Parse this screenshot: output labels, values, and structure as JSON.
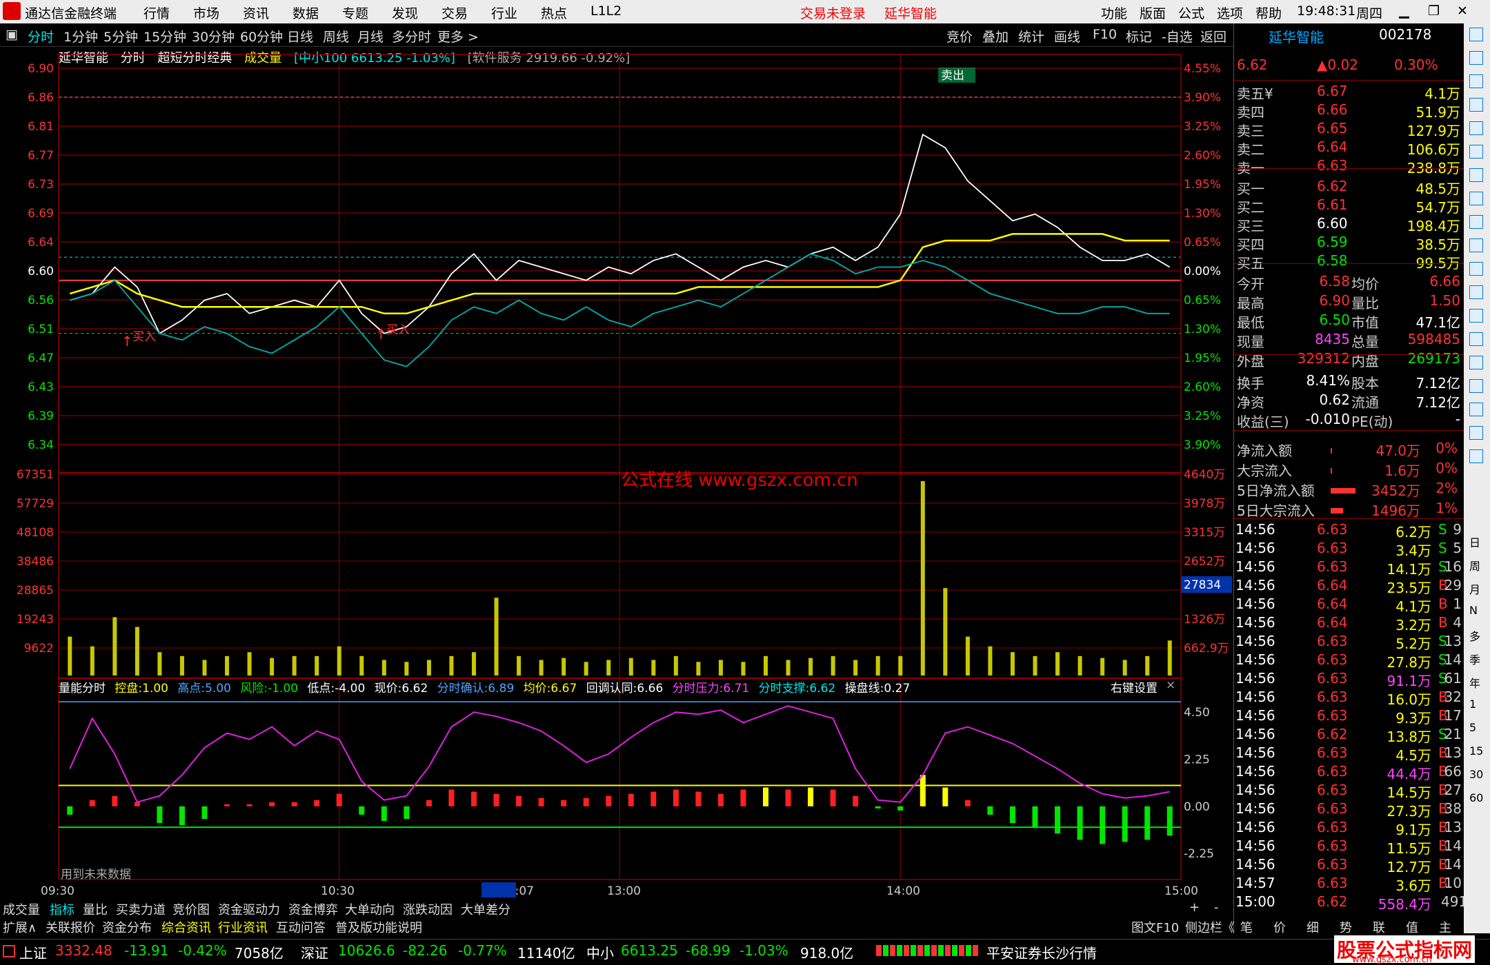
{
  "menu": {
    "app_title": "通达信金融终端",
    "items": [
      "行情",
      "市场",
      "资讯",
      "数据",
      "专题",
      "发现",
      "交易",
      "行业",
      "热点",
      "L1L2"
    ],
    "login": "交易未登录",
    "stock_name": "延华智能",
    "right_items": [
      "功能",
      "版面",
      "公式",
      "选项",
      "帮助"
    ],
    "time": "19:48:31",
    "weekday": "周四"
  },
  "toolbar": {
    "periods": [
      "分时",
      "1分钟",
      "5分钟",
      "15分钟",
      "30分钟",
      "60分钟",
      "日线",
      "周线",
      "月线",
      "多分时",
      "更多 >"
    ],
    "tools": [
      "竞价",
      "叠加",
      "统计",
      "画线",
      "F10",
      "标记",
      "-自选",
      "返回"
    ]
  },
  "chart_header": {
    "name": "延华智能",
    "mode": "分时",
    "formula": "超短分时经典",
    "vol_label": "成交量",
    "index1": "[中小100 6613.25 -1.03%]",
    "index2": "[软件服务 2919.66 -0.92%]"
  },
  "watermark": "公式在线 www.gszx.com.cn",
  "markers": {
    "buy": "买入",
    "sell": "卖出"
  },
  "chart_data": {
    "type": "line",
    "x_ticks": [
      "09:30",
      "10:30",
      "11:07",
      "13:00",
      "14:00",
      "15:00"
    ],
    "price_ticks": [
      "6.90",
      "6.86",
      "6.81",
      "6.77",
      "6.73",
      "6.69",
      "6.64",
      "6.60",
      "6.56",
      "6.51",
      "6.47",
      "6.43",
      "6.39",
      "6.34"
    ],
    "pct_ticks": [
      "4.55%",
      "3.90%",
      "3.25%",
      "2.60%",
      "1.95%",
      "1.30%",
      "0.65%",
      "0.00%",
      "0.65%",
      "1.30%",
      "1.95%",
      "2.60%",
      "3.25%",
      "3.90%"
    ],
    "vol_ticks": [
      "67351",
      "57729",
      "48108",
      "38486",
      "28865",
      "19243",
      "9622"
    ],
    "amt_ticks": [
      "4640万",
      "3978万",
      "3315万",
      "2652万",
      "1326万",
      "662.9万"
    ],
    "vol_cursor": "27834",
    "ylim": [
      6.32,
      6.92
    ],
    "series": [
      {
        "values": [
          6.57,
          6.58,
          6.62,
          6.59,
          6.52,
          6.54,
          6.57,
          6.58,
          6.55,
          6.56,
          6.57,
          6.56,
          6.6,
          6.55,
          6.52,
          6.53,
          6.56,
          6.61,
          6.64,
          6.6,
          6.63,
          6.62,
          6.61,
          6.6,
          6.62,
          6.61,
          6.63,
          6.64,
          6.62,
          6.6,
          6.62,
          6.63,
          6.62,
          6.64,
          6.65,
          6.63,
          6.65,
          6.7,
          6.82,
          6.8,
          6.75,
          6.72,
          6.69,
          6.7,
          6.68,
          6.65,
          6.63,
          6.63,
          6.64,
          6.62
        ]
      },
      {
        "values": [
          6.58,
          6.59,
          6.6,
          6.58,
          6.57,
          6.56,
          6.56,
          6.56,
          6.56,
          6.56,
          6.56,
          6.56,
          6.56,
          6.56,
          6.55,
          6.55,
          6.56,
          6.57,
          6.58,
          6.58,
          6.58,
          6.58,
          6.58,
          6.58,
          6.58,
          6.58,
          6.58,
          6.58,
          6.59,
          6.59,
          6.59,
          6.59,
          6.59,
          6.59,
          6.59,
          6.59,
          6.59,
          6.6,
          6.65,
          6.66,
          6.66,
          6.66,
          6.67,
          6.67,
          6.67,
          6.67,
          6.67,
          6.66,
          6.66,
          6.66
        ]
      },
      {
        "values": [
          6.57,
          6.58,
          6.6,
          6.56,
          6.52,
          6.51,
          6.53,
          6.52,
          6.5,
          6.49,
          6.51,
          6.53,
          6.56,
          6.52,
          6.48,
          6.47,
          6.5,
          6.54,
          6.56,
          6.55,
          6.57,
          6.55,
          6.54,
          6.56,
          6.54,
          6.53,
          6.55,
          6.56,
          6.57,
          6.56,
          6.58,
          6.6,
          6.62,
          6.64,
          6.63,
          6.61,
          6.62,
          6.62,
          6.63,
          6.62,
          6.6,
          6.58,
          6.57,
          6.56,
          6.55,
          6.55,
          6.56,
          6.56,
          6.55,
          6.55
        ]
      }
    ],
    "volumes": [
      0.2,
      0.15,
      0.3,
      0.25,
      0.12,
      0.1,
      0.08,
      0.1,
      0.12,
      0.09,
      0.1,
      0.1,
      0.15,
      0.1,
      0.08,
      0.07,
      0.08,
      0.1,
      0.12,
      0.4,
      0.1,
      0.08,
      0.09,
      0.07,
      0.08,
      0.09,
      0.08,
      0.1,
      0.07,
      0.08,
      0.07,
      0.1,
      0.08,
      0.09,
      0.1,
      0.08,
      0.1,
      0.1,
      1.0,
      0.45,
      0.2,
      0.15,
      0.12,
      0.1,
      0.12,
      0.1,
      0.09,
      0.08,
      0.1,
      0.18
    ],
    "ind_ticks": [
      "4.50",
      "2.25",
      "0.00",
      "-2.25"
    ],
    "ind_line": [
      1.8,
      4.2,
      2.5,
      0.2,
      0.5,
      1.5,
      2.8,
      3.5,
      3.2,
      3.8,
      2.9,
      3.6,
      3.2,
      1.2,
      0.3,
      0.5,
      1.9,
      3.8,
      4.5,
      4.3,
      4.0,
      3.6,
      2.9,
      2.1,
      2.5,
      3.3,
      4.0,
      4.5,
      4.4,
      4.6,
      4.0,
      4.4,
      4.8,
      4.5,
      4.2,
      1.8,
      0.3,
      0.2,
      1.5,
      3.5,
      3.8,
      3.4,
      3.0,
      2.4,
      1.8,
      1.1,
      0.6,
      0.4,
      0.5,
      0.7
    ],
    "ind_bars": [
      -0.4,
      0.3,
      0.5,
      0.2,
      -0.8,
      -0.9,
      -0.6,
      0.1,
      0.1,
      0.2,
      0.2,
      0.3,
      0.6,
      -0.4,
      -0.7,
      -0.6,
      0.3,
      0.8,
      0.7,
      0.6,
      0.5,
      0.4,
      0.3,
      0.4,
      0.5,
      0.6,
      0.7,
      0.8,
      0.7,
      0.6,
      0.8,
      0.9,
      0.8,
      0.9,
      0.8,
      0.5,
      -0.1,
      -0.2,
      1.5,
      0.9,
      0.3,
      -0.4,
      -0.8,
      -1.0,
      -1.3,
      -1.6,
      -1.8,
      -1.7,
      -1.6,
      -1.4
    ]
  },
  "indicator": {
    "name": "量能分时",
    "items": [
      [
        "控盘:",
        "1.00"
      ],
      [
        "高点:",
        "5.00"
      ],
      [
        "风险:",
        "-1.00"
      ],
      [
        "低点:",
        "-4.00"
      ],
      [
        "现价:",
        "6.62"
      ],
      [
        "分时确认:",
        "6.89"
      ],
      [
        "均价:",
        "6.67"
      ],
      [
        "回调认同:",
        "6.66"
      ],
      [
        "分时压力:",
        "6.71"
      ],
      [
        "分时支撑:",
        "6.62"
      ],
      [
        "操盘线:",
        "0.27"
      ]
    ],
    "right_setting": "右键设置",
    "future_note": "用到未来数据"
  },
  "quote": {
    "name": "延华智能",
    "code": "002178",
    "price": "6.62",
    "change": "▲0.02",
    "pct": "0.30%",
    "asks": [
      [
        "卖五¥",
        "6.67",
        "4.1万"
      ],
      [
        "卖四",
        "6.66",
        "51.9万"
      ],
      [
        "卖三",
        "6.65",
        "127.9万"
      ],
      [
        "卖二",
        "6.64",
        "106.6万"
      ],
      [
        "卖一",
        "6.63",
        "238.8万"
      ]
    ],
    "bids": [
      [
        "买一",
        "6.62",
        "48.5万"
      ],
      [
        "买二",
        "6.61",
        "54.7万"
      ],
      [
        "买三",
        "6.60",
        "198.4万"
      ],
      [
        "买四",
        "6.59",
        "38.5万"
      ],
      [
        "买五",
        "6.58",
        "99.5万"
      ]
    ],
    "stats": [
      [
        "今开",
        "6.58",
        "均价",
        "6.66"
      ],
      [
        "最高",
        "6.90",
        "量比",
        "1.50"
      ],
      [
        "最低",
        "6.50",
        "市值",
        "47.1亿"
      ],
      [
        "现量",
        "8435",
        "总量",
        "598485"
      ],
      [
        "外盘",
        "329312",
        "内盘",
        "269173"
      ]
    ],
    "stats2": [
      [
        "换手",
        "8.41%",
        "股本",
        "7.12亿"
      ],
      [
        "净资",
        "0.62",
        "流通",
        "7.12亿"
      ],
      [
        "收益(三)",
        "-0.010",
        "PE(动)",
        "-"
      ]
    ],
    "flows": [
      [
        "净流入额",
        "47.0万",
        "0%"
      ],
      [
        "大宗流入",
        "1.6万",
        "0%"
      ],
      [
        "5日净流入额",
        "3452万",
        "2%"
      ],
      [
        "5日大宗流入",
        "1496万",
        "1%"
      ]
    ],
    "ticks": [
      [
        "14:56",
        "6.63",
        "6.2万",
        "S",
        "9"
      ],
      [
        "14:56",
        "6.63",
        "3.4万",
        "S",
        "5"
      ],
      [
        "14:56",
        "6.63",
        "14.1万",
        "S",
        "16"
      ],
      [
        "14:56",
        "6.64",
        "23.5万",
        "B",
        "29"
      ],
      [
        "14:56",
        "6.64",
        "4.1万",
        "B",
        "1"
      ],
      [
        "14:56",
        "6.64",
        "3.2万",
        "B",
        "4"
      ],
      [
        "14:56",
        "6.63",
        "5.2万",
        "S",
        "13"
      ],
      [
        "14:56",
        "6.63",
        "27.8万",
        "S",
        "14"
      ],
      [
        "14:56",
        "6.63",
        "91.1万",
        "S",
        "61"
      ],
      [
        "14:56",
        "6.63",
        "16.0万",
        "B",
        "32"
      ],
      [
        "14:56",
        "6.63",
        "9.3万",
        "B",
        "17"
      ],
      [
        "14:56",
        "6.62",
        "13.8万",
        "S",
        "21"
      ],
      [
        "14:56",
        "6.63",
        "4.5万",
        "B",
        "13"
      ],
      [
        "14:56",
        "6.63",
        "44.4万",
        "B",
        "66"
      ],
      [
        "14:56",
        "6.63",
        "14.5万",
        "B",
        "27"
      ],
      [
        "14:56",
        "6.63",
        "27.3万",
        "B",
        "38"
      ],
      [
        "14:56",
        "6.63",
        "9.1万",
        "B",
        "13"
      ],
      [
        "14:56",
        "6.63",
        "11.5万",
        "B",
        "14"
      ],
      [
        "14:56",
        "6.63",
        "12.7万",
        "B",
        "14"
      ],
      [
        "14:57",
        "6.63",
        "3.6万",
        "B",
        "10"
      ],
      [
        "15:00",
        "6.62",
        "558.4万",
        "",
        "491"
      ]
    ]
  },
  "strip": [
    "日",
    "周",
    "月",
    "N",
    "多",
    "季",
    "年",
    "1",
    "5",
    "15",
    "30",
    "60"
  ],
  "bottom_tabs1": [
    "成交量",
    "指标",
    "量比",
    "买卖力道",
    "竞价图",
    "资金驱动力",
    "资金博弈",
    "大单动向",
    "涨跌动因",
    "大单差分"
  ],
  "bottom_tabs2": [
    "扩展∧",
    "关联报价",
    "资金分布",
    "综合资讯",
    "行业资讯",
    "互动问答",
    "普及版功能说明"
  ],
  "bottom_right": [
    "图文F10",
    "侧边栏《",
    "笔",
    "价",
    "细",
    "势",
    "联",
    "值",
    "主"
  ],
  "status": {
    "sh_label": "上证",
    "sh": "3332.48",
    "sh_chg": "-13.91",
    "sh_pct": "-0.42%",
    "sh_amt": "7058亿",
    "sz_label": "深证",
    "sz": "10626.6",
    "sz_chg": "-82.26",
    "sz_pct": "-0.77%",
    "sz_amt": "11140亿",
    "zx_label": "中小",
    "zx": "6613.25",
    "zx_chg": "-68.99",
    "zx_pct": "-1.03%",
    "zx_amt": "918.0亿",
    "broker": "平安证券长沙行情",
    "logo_title": "股票公式指标网",
    "logo_url": "www.gszx.com.cn"
  },
  "colors": {
    "up": "#ff3232",
    "down": "#00e600",
    "price_line": "#ffffff",
    "avg_line": "#ffff00",
    "grid": "#8b0000"
  }
}
